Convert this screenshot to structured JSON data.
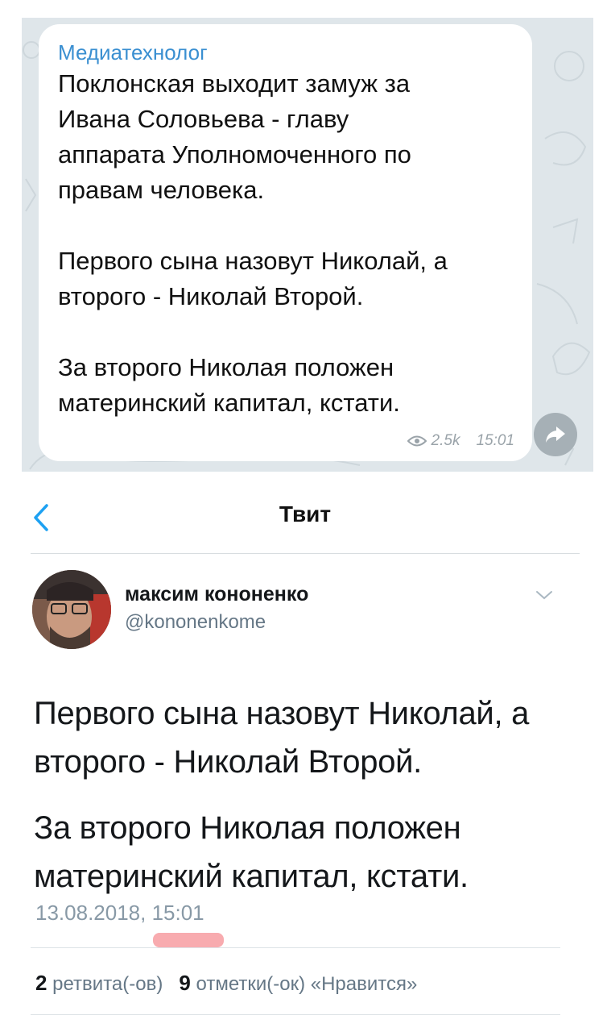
{
  "telegram": {
    "sender": "Медиатехнолог",
    "message": "Поклонская выходит замуж за\nИвана Соловьева - главу\nаппарата Уполномоченного по\nправам человека.\n\nПервого сына назовут Николай, а\nвторого - Николай Второй.\n\nЗа второго Николая положен\nматеринский капитал, кстати.",
    "views": "2.5k",
    "time": "15:01",
    "icons": [
      "eye-icon",
      "share-arrow-icon"
    ]
  },
  "twitter": {
    "nav_title": "Твит",
    "user_name": "максим кононенко",
    "user_handle": "@kononenkome",
    "tweet_paragraphs": [
      "Первого сына назовут Николай, а второго - Николай Второй.",
      "За второго Николая положен материнский капитал, кстати."
    ],
    "timestamp": "13.08.2018, 15:01",
    "retweets_count": "2",
    "retweets_label": "ретвита(-ов)",
    "likes_count": "9",
    "likes_label": "отметки(-ок) «Нравится»",
    "icons": [
      "back-chevron-icon",
      "chevron-down-icon"
    ]
  },
  "colors": {
    "telegram_link": "#3a8fd1",
    "twitter_accent": "#1da1f2",
    "highlight": "#f7a2a6"
  }
}
